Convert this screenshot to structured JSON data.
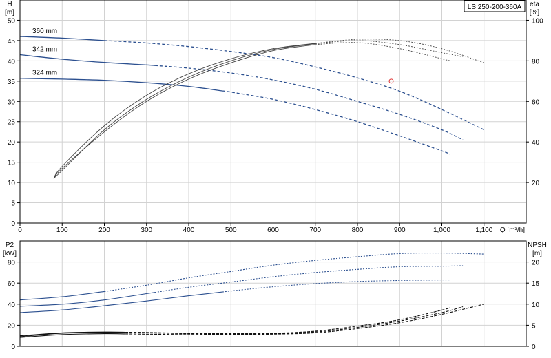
{
  "title_box": "LS 250-200-360A",
  "colors": {
    "head_curve": "#2b4f8f",
    "eff_curve": "#444444",
    "p2_curve": "#2b4f8f",
    "npsh_curve": "#111111",
    "duty_point": "#e03030",
    "grid": "#d2d2d2"
  },
  "chart_data": [
    {
      "type": "line",
      "xlabel": "Q [m³/h]",
      "ylabel": "H\n[m]",
      "ylabel_right": "eta\n[%]",
      "xlim": [
        0,
        1200
      ],
      "ylim": [
        0,
        55
      ],
      "ylim_right_range": [
        0,
        110
      ],
      "x_ticks": [
        0,
        100,
        200,
        300,
        400,
        500,
        600,
        700,
        800,
        900,
        1000,
        1100
      ],
      "x_tick_labels": [
        "0",
        "100",
        "200",
        "300",
        "400",
        "500",
        "600",
        "700",
        "800",
        "900",
        "1,000",
        "1,100"
      ],
      "y_ticks": [
        0,
        5,
        10,
        15,
        20,
        25,
        30,
        35,
        40,
        45,
        50
      ],
      "y_right_ticks": [
        20,
        40,
        60,
        80,
        100
      ],
      "grid": true,
      "series": [
        {
          "name": "360 mm",
          "kind": "head",
          "solid_until": 200,
          "points": [
            [
              0,
              46
            ],
            [
              100,
              45.6
            ],
            [
              200,
              45
            ],
            [
              300,
              44.4
            ],
            [
              400,
              43.5
            ],
            [
              500,
              42.3
            ],
            [
              600,
              40.8
            ],
            [
              700,
              38.5
            ],
            [
              800,
              35.8
            ],
            [
              900,
              32.5
            ],
            [
              1000,
              28
            ],
            [
              1100,
              23
            ]
          ]
        },
        {
          "name": "342 mm",
          "kind": "head",
          "solid_until": 320,
          "points": [
            [
              0,
              41.5
            ],
            [
              100,
              40.4
            ],
            [
              200,
              39.6
            ],
            [
              300,
              39
            ],
            [
              400,
              38.2
            ],
            [
              500,
              37
            ],
            [
              600,
              35.3
            ],
            [
              700,
              33
            ],
            [
              800,
              30
            ],
            [
              900,
              26.8
            ],
            [
              1000,
              23
            ],
            [
              1050,
              20.5
            ]
          ]
        },
        {
          "name": "324 mm",
          "kind": "head",
          "solid_until": 480,
          "points": [
            [
              0,
              35.7
            ],
            [
              100,
              35.5
            ],
            [
              200,
              35.2
            ],
            [
              300,
              34.6
            ],
            [
              400,
              33.7
            ],
            [
              500,
              32.3
            ],
            [
              600,
              30.5
            ],
            [
              700,
              28
            ],
            [
              800,
              25
            ],
            [
              900,
              21.5
            ],
            [
              1000,
              17.8
            ],
            [
              1020,
              17
            ]
          ]
        },
        {
          "name": "",
          "kind": "eff",
          "points": [
            [
              80,
              11
            ],
            [
              100,
              13.5
            ],
            [
              200,
              22.5
            ],
            [
              300,
              30
            ],
            [
              400,
              35.5
            ],
            [
              500,
              39.5
            ],
            [
              600,
              42.5
            ],
            [
              700,
              44
            ],
            [
              800,
              44.5
            ],
            [
              900,
              43
            ],
            [
              1000,
              40.5
            ],
            [
              1020,
              40
            ]
          ]
        },
        {
          "name": "",
          "kind": "eff",
          "points": [
            [
              80,
              11
            ],
            [
              100,
              13
            ],
            [
              200,
              23
            ],
            [
              300,
              30.5
            ],
            [
              400,
              36
            ],
            [
              500,
              40
            ],
            [
              600,
              42.8
            ],
            [
              700,
              44.2
            ],
            [
              800,
              45
            ],
            [
              900,
              44
            ],
            [
              1000,
              42
            ],
            [
              1050,
              41
            ]
          ]
        },
        {
          "name": "",
          "kind": "eff",
          "points": [
            [
              80,
              11
            ],
            [
              100,
              14
            ],
            [
              200,
              24
            ],
            [
              300,
              31.5
            ],
            [
              400,
              36.8
            ],
            [
              500,
              40.5
            ],
            [
              600,
              43
            ],
            [
              700,
              44.3
            ],
            [
              800,
              45.3
            ],
            [
              900,
              45
            ],
            [
              1000,
              43
            ],
            [
              1100,
              39.5
            ]
          ]
        }
      ],
      "duty_point": {
        "x": 880,
        "y": 35
      }
    },
    {
      "type": "line",
      "xlim": [
        0,
        1200
      ],
      "ylabel": "P2\n[kW]",
      "ylabel_right": "NPSH\n[m]",
      "ylim": [
        0,
        100
      ],
      "ylim_right_range": [
        0,
        25
      ],
      "y_ticks": [
        0,
        20,
        40,
        60,
        80
      ],
      "y_right_ticks": [
        0,
        5,
        10,
        15,
        20
      ],
      "grid": true,
      "series": [
        {
          "name": "",
          "kind": "p2",
          "solid_until": 200,
          "points": [
            [
              0,
              44
            ],
            [
              100,
              47
            ],
            [
              200,
              52
            ],
            [
              300,
              58
            ],
            [
              400,
              65
            ],
            [
              500,
              71
            ],
            [
              600,
              77
            ],
            [
              700,
              81.5
            ],
            [
              800,
              85
            ],
            [
              900,
              88
            ],
            [
              1000,
              88.5
            ],
            [
              1100,
              87.5
            ]
          ]
        },
        {
          "name": "",
          "kind": "p2",
          "solid_until": 320,
          "points": [
            [
              0,
              38
            ],
            [
              100,
              40
            ],
            [
              200,
              44
            ],
            [
              300,
              50
            ],
            [
              400,
              56
            ],
            [
              500,
              61
            ],
            [
              600,
              66
            ],
            [
              700,
              70
            ],
            [
              800,
              73
            ],
            [
              900,
              75.5
            ],
            [
              1000,
              76
            ],
            [
              1050,
              76.5
            ]
          ]
        },
        {
          "name": "",
          "kind": "p2",
          "solid_until": 480,
          "points": [
            [
              0,
              32
            ],
            [
              100,
              34.5
            ],
            [
              200,
              38.5
            ],
            [
              300,
              43
            ],
            [
              400,
              48
            ],
            [
              500,
              52.5
            ],
            [
              600,
              56.5
            ],
            [
              700,
              59.5
            ],
            [
              800,
              61.5
            ],
            [
              900,
              62.5
            ],
            [
              1000,
              63
            ],
            [
              1020,
              63
            ]
          ]
        },
        {
          "name": "",
          "kind": "npsh",
          "points": [
            [
              0,
              2.5
            ],
            [
              100,
              3.2
            ],
            [
              200,
              3.4
            ],
            [
              300,
              3.3
            ],
            [
              400,
              3.1
            ],
            [
              500,
              3
            ],
            [
              600,
              3.1
            ],
            [
              700,
              3.6
            ],
            [
              800,
              4.8
            ],
            [
              900,
              6.3
            ],
            [
              1000,
              8.6
            ],
            [
              1020,
              9.2
            ]
          ]
        },
        {
          "name": "",
          "kind": "npsh",
          "points": [
            [
              0,
              2.3
            ],
            [
              100,
              3.1
            ],
            [
              200,
              3.3
            ],
            [
              300,
              3.2
            ],
            [
              400,
              3
            ],
            [
              500,
              2.9
            ],
            [
              600,
              3
            ],
            [
              700,
              3.4
            ],
            [
              800,
              4.5
            ],
            [
              900,
              6
            ],
            [
              1000,
              8
            ],
            [
              1050,
              9.4
            ]
          ]
        },
        {
          "name": "",
          "kind": "npsh",
          "points": [
            [
              0,
              2.1
            ],
            [
              100,
              2.8
            ],
            [
              200,
              3
            ],
            [
              300,
              2.9
            ],
            [
              400,
              2.8
            ],
            [
              500,
              2.8
            ],
            [
              600,
              2.9
            ],
            [
              700,
              3.2
            ],
            [
              800,
              4.2
            ],
            [
              900,
              5.6
            ],
            [
              1000,
              7.6
            ],
            [
              1100,
              10
            ]
          ]
        }
      ]
    }
  ]
}
